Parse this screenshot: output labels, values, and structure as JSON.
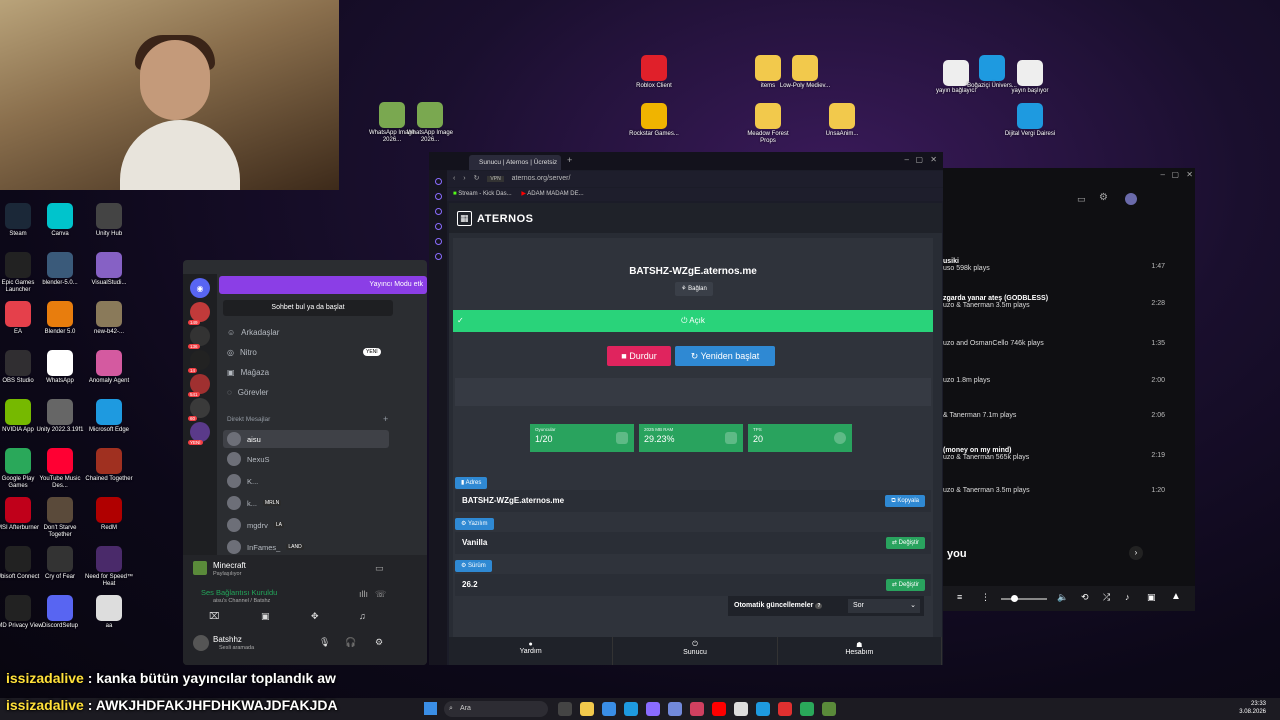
{
  "desktop_icons_left": [
    {
      "label": "Steam",
      "color": "#1b2838"
    },
    {
      "label": "Canva",
      "color": "#00c4cc"
    },
    {
      "label": "Unity Hub",
      "color": "#444"
    },
    {
      "label": "Epic Games Launcher",
      "color": "#222"
    },
    {
      "label": "blender-5.0...",
      "color": "#3a5a7a"
    },
    {
      "label": "VisualStudi...",
      "color": "#8661c5"
    },
    {
      "label": "EA",
      "color": "#e5404b"
    },
    {
      "label": "Blender 5.0",
      "color": "#e87d0d"
    },
    {
      "label": "new-b42-...",
      "color": "#8a7a5a"
    },
    {
      "label": "OBS Studio",
      "color": "#302e31"
    },
    {
      "label": "WhatsApp",
      "color": "#ffffff"
    },
    {
      "label": "Anomaly Agent",
      "color": "#d45aa0"
    },
    {
      "label": "NVIDIA App",
      "color": "#76b900"
    },
    {
      "label": "Unity 2022.3.19f1",
      "color": "#666"
    },
    {
      "label": "Microsoft Edge",
      "color": "#1e9ae0"
    },
    {
      "label": "Google Play Games",
      "color": "#2aa85a"
    },
    {
      "label": "YouTube Music Des...",
      "color": "#ff0033"
    },
    {
      "label": "Chained Together",
      "color": "#a03020"
    },
    {
      "label": "MSI Afterburner",
      "color": "#c0001a"
    },
    {
      "label": "Don't Starve Together",
      "color": "#5a4a3a"
    },
    {
      "label": "RedM",
      "color": "#b00000"
    },
    {
      "label": "Ubisoft Connect",
      "color": "#222"
    },
    {
      "label": "Cry of Fear",
      "color": "#333"
    },
    {
      "label": "Need for Speed™ Heat",
      "color": "#4a2a6a"
    },
    {
      "label": "AMD Privacy View",
      "color": "#222"
    },
    {
      "label": "DiscordSetup",
      "color": "#5865f2"
    },
    {
      "label": "aa",
      "color": "#ddd"
    }
  ],
  "desktop_icons_top": [
    {
      "label": "WhatsApp Image 2026...",
      "color": "#7aa850"
    },
    {
      "label": "WhatsApp Image 2026...",
      "color": "#7aa850"
    },
    {
      "label": "Roblox Client",
      "color": "#e0202a"
    },
    {
      "label": "Rockstar Games...",
      "color": "#f0b400"
    },
    {
      "label": "items",
      "color": "#f2c94c"
    },
    {
      "label": "Low-Poly Mediev...",
      "color": "#f2c94c"
    },
    {
      "label": "Meadow Forest Props",
      "color": "#f2c94c"
    },
    {
      "label": "UnsaAnim...",
      "color": "#f2c94c"
    },
    {
      "label": "yayın bağlayıcı",
      "color": "#eee"
    },
    {
      "label": "Boğaziçi Ünivers...",
      "color": "#1e9ae0"
    },
    {
      "label": "yayın başlıyor",
      "color": "#eee"
    },
    {
      "label": "Dijital Vergi Dairesi",
      "color": "#1e9ae0"
    }
  ],
  "discord": {
    "mode_banner": "Yayıncı Modu etk",
    "search_placeholder": "Sohbet bul ya da başlat",
    "nav": [
      {
        "label": "Arkadaşlar"
      },
      {
        "label": "Nitro",
        "badge": "YENİ"
      },
      {
        "label": "Mağaza"
      },
      {
        "label": "Görevler"
      }
    ],
    "dm_header": "Direkt Mesajlar",
    "dms": [
      "aisu",
      "NexuS",
      "K...",
      "k...",
      "mgdrv",
      "InFames_"
    ],
    "dm_tags": [
      "",
      "",
      "",
      "MRLN",
      "LA",
      "LAND"
    ],
    "server_badges": [
      "149",
      "136",
      "14",
      "541",
      "60",
      "YENİ"
    ],
    "activity_title": "Minecraft",
    "activity_sub": "Paylaşılıyor",
    "voice_status": "Ses Bağlantısı Kuruldu",
    "voice_channel": "aisu's Channel / Batshz",
    "username": "Batshhz",
    "user_status": "Sesli aramada"
  },
  "browser": {
    "tab_title": "Sunucu | Aternos | Ücretsiz",
    "url": "aternos.org/server/",
    "bookmarks": [
      "Stream - Kick Das...",
      "ADAM MADAM DE..."
    ]
  },
  "aternos": {
    "brand": "ATERNOS",
    "server_address": "BATSHZ-WZgE.aternos.me",
    "connect_label": "Bağlan",
    "status": "Açık",
    "stop_label": "Durdur",
    "restart_label": "Yeniden başlat",
    "stats": [
      {
        "label": "Oyuncular",
        "value": "1/20"
      },
      {
        "label": "2025 MB RAM",
        "value": "29.23%"
      },
      {
        "label": "TPS",
        "value": "20"
      }
    ],
    "address_tag": "Adres",
    "address_value": "BATSHZ-WZgE.aternos.me",
    "copy_label": "Kopyala",
    "software_tag": "Yazılım",
    "software_value": "Vanilla",
    "change_label": "Değiştir",
    "version_tag": "Sürüm",
    "version_value": "26.2",
    "auto_update_label": "Otomatik güncellemeler",
    "auto_update_value": "Sor",
    "nav": [
      "Yardım",
      "Sunucu",
      "Hesabım"
    ],
    "colors": {
      "green": "#29d37a",
      "red": "#e0245e",
      "blue": "#2f89d3"
    }
  },
  "music": {
    "songs": [
      {
        "title": "usiki",
        "meta": "uso 598k plays",
        "duration": "1:47"
      },
      {
        "title": "zgarda yanar ateş (GODBLESS)",
        "meta": "uzo & Tanerman 3.5m plays",
        "duration": "2:28"
      },
      {
        "title": "",
        "meta": "uzo and OsmanCello 746k plays",
        "duration": "1:35"
      },
      {
        "title": "",
        "meta": "uzo 1.8m plays",
        "duration": "2:00"
      },
      {
        "title": "",
        "meta": "& Tanerman 7.1m plays",
        "duration": "2:06"
      },
      {
        "title": "(money on my mind)",
        "meta": "uzo & Tanerman 565k plays",
        "duration": "2:19"
      },
      {
        "title": "",
        "meta": "uzo & Tanerman 3.5m plays",
        "duration": "1:20"
      }
    ],
    "section_label": "you"
  },
  "chat": [
    {
      "user": "issizadalive",
      "msg": "kanka bütün yayıncılar toplandık aw"
    },
    {
      "user": "issizadalive",
      "msg": "AWKJHDFAKJHFDHKWAJDFAKJDA"
    }
  ],
  "taskbar": {
    "search_placeholder": "Ara",
    "time": "23:33",
    "date": "3.08.2026"
  }
}
